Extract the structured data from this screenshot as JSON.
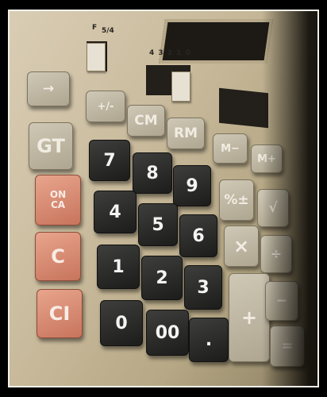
{
  "switch_labels": {
    "left_f": "F",
    "left_54": "5/4",
    "right_digits": "4 3 2 1 0"
  },
  "keys": {
    "arrow": "→",
    "plus_minus": "+/-",
    "cm": "CM",
    "rm": "RM",
    "gt": "GT",
    "on_ca_top": "ON",
    "on_ca_bottom": "CA",
    "c": "C",
    "ci": "CI",
    "m_minus": "M−",
    "m_plus": "M+",
    "percent": "%±",
    "sqrt": "√",
    "multiply": "×",
    "divide": "÷",
    "plus": "+",
    "minus": "−",
    "equals": "=",
    "d7": "7",
    "d8": "8",
    "d9": "9",
    "d4": "4",
    "d5": "5",
    "d6": "6",
    "d1": "1",
    "d2": "2",
    "d3": "3",
    "d0": "0",
    "d00": "00",
    "dot": "."
  },
  "colors": {
    "body": "#cbbd9f",
    "gray_key": "#b8b09b",
    "dark_key": "#2b2b2a",
    "salmon_key": "#d98a72"
  }
}
